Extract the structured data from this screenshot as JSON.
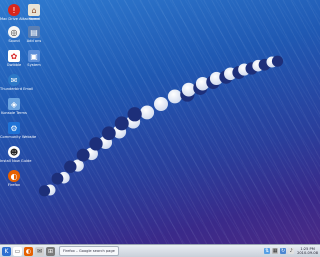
{
  "desktop_icons": [
    {
      "label": "Mac Drive Attachment",
      "icon": "warning-icon",
      "color": "#d9261c"
    },
    {
      "label": "Home",
      "icon": "home-icon",
      "color": "#e8e3d6"
    },
    {
      "label": "Sound",
      "icon": "soundwave-icon",
      "color": "#f5f5f5"
    },
    {
      "label": "Add ons",
      "icon": "computer-icon",
      "color": "#5a7fb4"
    },
    {
      "label": "Gwibble",
      "icon": "gwibber-icon",
      "color": "#ffffff"
    },
    {
      "label": "System",
      "icon": "monitor-icon",
      "color": "#5b8ed8"
    },
    {
      "label": "Thunderbird Email",
      "icon": "thunderbird-icon",
      "color": "#2d79c7"
    },
    {
      "label": "Konsole Terms",
      "icon": "mail-icon",
      "color": "#6aa3e0"
    },
    {
      "label": "Community Website",
      "icon": "kde-logo-icon",
      "color": "#1f73d6"
    },
    {
      "label": "Install Now Guide",
      "icon": "penguin-icon",
      "color": "#ffffff"
    },
    {
      "label": "Firefox",
      "icon": "firefox-icon",
      "color": "#e66000"
    }
  ],
  "panel": {
    "task_label": "Firefox – Google search page",
    "clock_time": "1:25 PM",
    "clock_date": "2010-09-08"
  }
}
